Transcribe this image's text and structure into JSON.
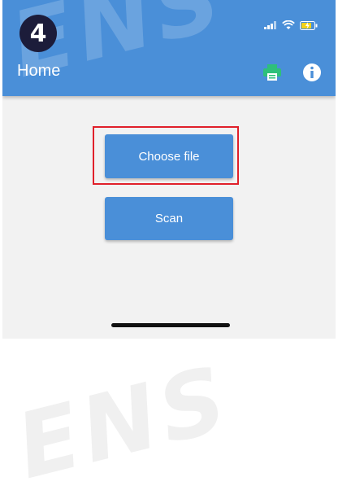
{
  "step_badge": "4",
  "appbar": {
    "title": "Home",
    "print_icon": "printer-icon",
    "info_icon": "info-icon"
  },
  "status_bar": {
    "icons": [
      "signal-icon",
      "wifi-icon",
      "battery-charging-icon"
    ]
  },
  "buttons": {
    "choose_file": "Choose file",
    "scan": "Scan"
  },
  "colors": {
    "appbar": "#4a8fd8",
    "print_icon": "#2ec07a",
    "highlight": "#e0202a",
    "badge": "#1c1c3a"
  }
}
